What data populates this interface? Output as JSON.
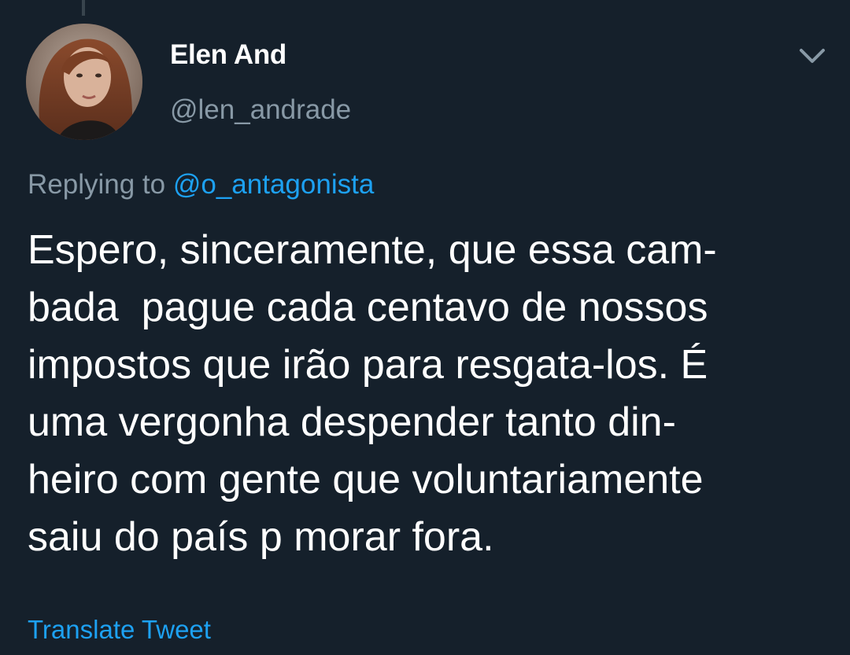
{
  "author": {
    "display_name": "Elen And",
    "handle": "@len_andrade",
    "avatar": "profile-photo"
  },
  "reply": {
    "prefix": "Replying to",
    "mention": "@o_antagonista"
  },
  "tweet": {
    "lines": [
      "Espero, sinceramente, que essa cam-",
      "bada  pague cada centavo de nossos",
      "impostos que irão para resgata-los. É",
      "uma vergonha despender tanto din-",
      "heiro com gente que voluntariamente",
      "saiu do país p morar fora."
    ]
  },
  "actions": {
    "translate_label": "Translate Tweet",
    "menu_icon": "chevron-down-icon"
  },
  "colors": {
    "background": "#15202b",
    "primary_text": "#ffffff",
    "secondary_text": "#8899a6",
    "link": "#1da1f2"
  }
}
